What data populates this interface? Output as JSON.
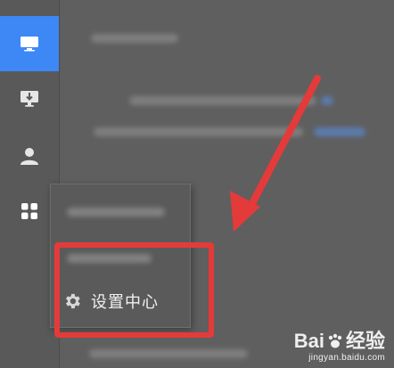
{
  "sidebar": {
    "items": [
      {
        "icon": "monitor-icon",
        "active": true
      },
      {
        "icon": "download-monitor-icon",
        "active": false
      },
      {
        "icon": "user-icon",
        "active": false
      },
      {
        "icon": "apps-grid-icon",
        "active": false
      }
    ]
  },
  "menu": {
    "settings_label": "设置中心"
  },
  "watermark": {
    "logo_left": "Bai",
    "logo_right": "经验",
    "sub": "jingyan.baidu.com"
  },
  "colors": {
    "active": "#3d88f5",
    "highlight": "#e53a3a",
    "arrow": "#e53a3a",
    "background": "#5f5f5f"
  }
}
